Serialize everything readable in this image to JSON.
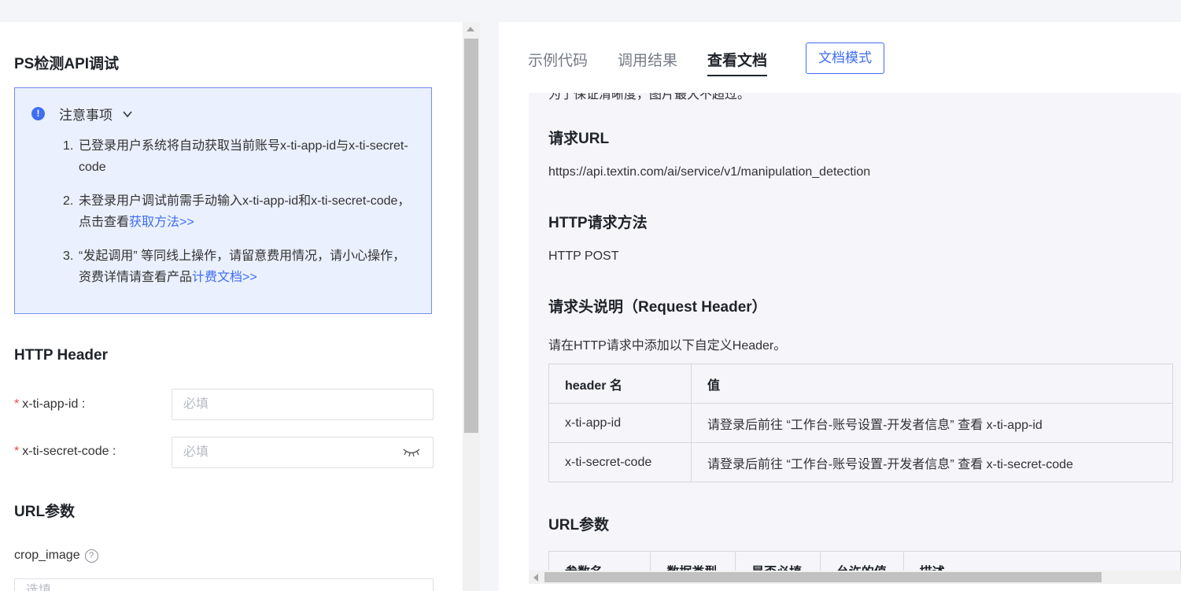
{
  "left": {
    "title": "PS检测API调试",
    "notice": {
      "title": "注意事项",
      "items": [
        {
          "num": "1.",
          "text": "已登录用户系统将自动获取当前账号x-ti-app-id与x-ti-secret-code",
          "link": ""
        },
        {
          "num": "2.",
          "text": "未登录用户调试前需手动输入x-ti-app-id和x-ti-secret-code，点击查看",
          "link": "获取方法>>"
        },
        {
          "num": "3.",
          "text": "“发起调用” 等同线上操作，请留意费用情况，请小心操作，资费详情请查看产品",
          "link": "计费文档>>"
        }
      ]
    },
    "http_header": {
      "title": "HTTP Header",
      "fields": [
        {
          "label": "x-ti-app-id :",
          "placeholder": "必填"
        },
        {
          "label": "x-ti-secret-code :",
          "placeholder": "必填"
        }
      ]
    },
    "url_params": {
      "title": "URL参数",
      "crop_image_label": "crop_image",
      "crop_image_placeholder": "选填"
    }
  },
  "right": {
    "tabs": [
      {
        "label": "示例代码",
        "active": false
      },
      {
        "label": "调用结果",
        "active": false
      },
      {
        "label": "查看文档",
        "active": true
      }
    ],
    "doc_mode_button": "文档模式",
    "doc": {
      "cut_text": "为了保证清晰度，图片最大不超过。",
      "request_url_title": "请求URL",
      "request_url": "https://api.textin.com/ai/service/v1/manipulation_detection",
      "method_title": "HTTP请求方法",
      "method": "HTTP POST",
      "req_header_title": "请求头说明（Request Header）",
      "req_header_desc": "请在HTTP请求中添加以下自定义Header。",
      "header_table": {
        "columns": [
          "header 名",
          "值"
        ],
        "rows": [
          [
            "x-ti-app-id",
            "请登录后前往 “工作台-账号设置-开发者信息” 查看 x-ti-app-id"
          ],
          [
            "x-ti-secret-code",
            "请登录后前往 “工作台-账号设置-开发者信息” 查看 x-ti-secret-code"
          ]
        ]
      },
      "url_params_title": "URL参数",
      "url_table_columns": [
        "参数名",
        "数据类型",
        "是否必填",
        "允许的值",
        "描述"
      ]
    }
  },
  "colors": {
    "accent": "#3f6df1",
    "notice_bg": "#eaf0fd",
    "required": "#e5484d"
  }
}
